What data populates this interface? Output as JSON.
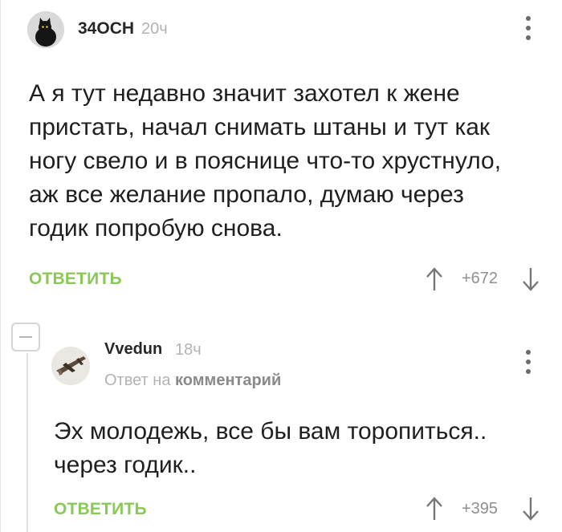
{
  "comments": [
    {
      "username": "34OCH",
      "time": "20ч",
      "text_lines": [
        "А я тут недавно значит захотел к жене",
        "пристать, начал снимать штаны и тут как",
        "ногу свело и в пояснице что-то хрустнуло,",
        "аж все желание пропало, думаю через",
        "годик попробую снова."
      ],
      "reply_label": "ОТВЕТИТЬ",
      "rating": "+672"
    },
    {
      "username": "Vvedun",
      "time": "18ч",
      "reply_to_prefix": "Ответ на",
      "reply_to_link": "комментарий",
      "text_lines": [
        "Эх молодежь, все бы вам торопиться..",
        "через годик.."
      ],
      "reply_label": "ОТВЕТИТЬ",
      "rating": "+395"
    }
  ],
  "colors": {
    "accent_green": "#8ac858",
    "meta_gray": "#b3b3b3",
    "text": "#1f1f1f"
  },
  "icons": {
    "avatar_1": "black-cat-avatar",
    "avatar_2": "airplane-avatar",
    "more": "vertical-dots-icon",
    "up": "arrow-up-icon",
    "down": "arrow-down-icon",
    "collapse": "collapse-minus-icon"
  }
}
